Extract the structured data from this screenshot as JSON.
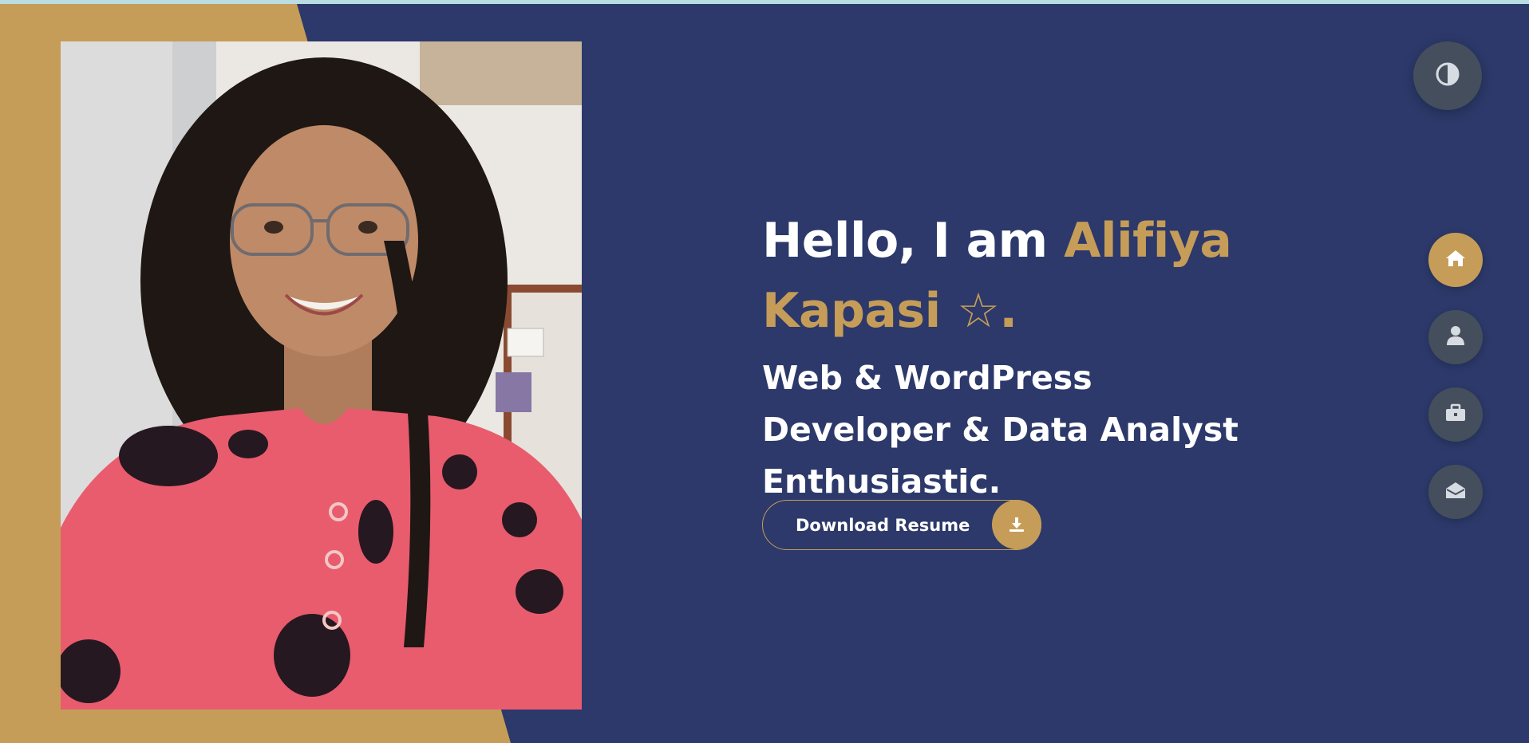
{
  "hero": {
    "title_prefix": "Hello, I am ",
    "name": "Alifiya Kapasi ☆.",
    "subtitle": "Web & WordPress Developer & Data Analyst Enthusiastic."
  },
  "resume_button": {
    "label": "Download Resume",
    "icon": "download-icon"
  },
  "theme_toggle": {
    "icon": "contrast-icon"
  },
  "nav": {
    "items": [
      {
        "name": "home",
        "icon": "home-icon",
        "active": true
      },
      {
        "name": "about",
        "icon": "user-icon",
        "active": false
      },
      {
        "name": "portfolio",
        "icon": "briefcase-icon",
        "active": false
      },
      {
        "name": "contact",
        "icon": "envelope-open-icon",
        "active": false
      }
    ]
  },
  "profile_photo": {
    "subject": "portrait-photo"
  },
  "colors": {
    "background": "#2c396a",
    "accent": "#c69d58",
    "top_strip": "#b9dde2",
    "button_dark": "#454e5d",
    "text": "#ffffff"
  }
}
